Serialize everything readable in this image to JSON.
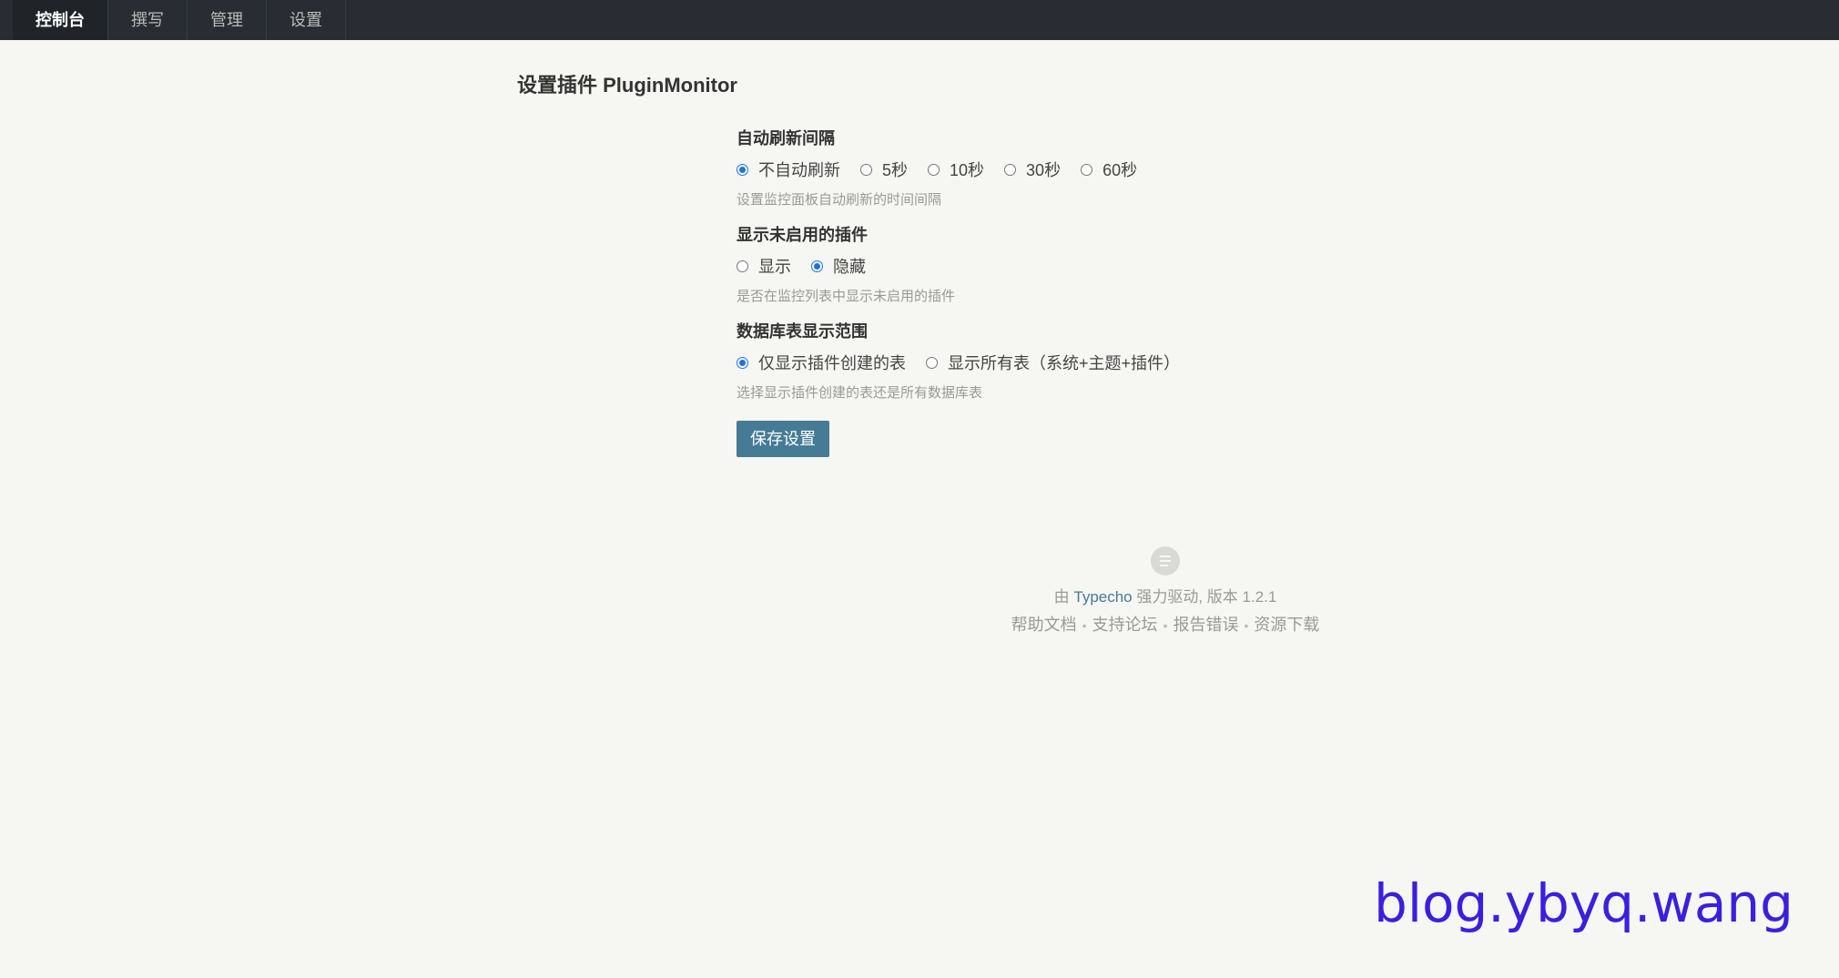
{
  "nav": {
    "items": [
      {
        "label": "控制台",
        "active": true
      },
      {
        "label": "撰写",
        "active": false
      },
      {
        "label": "管理",
        "active": false
      },
      {
        "label": "设置",
        "active": false
      }
    ]
  },
  "page": {
    "title": "设置插件 PluginMonitor"
  },
  "form": {
    "refresh": {
      "label": "自动刷新间隔",
      "options": [
        {
          "label": "不自动刷新",
          "checked": true
        },
        {
          "label": "5秒",
          "checked": false
        },
        {
          "label": "10秒",
          "checked": false
        },
        {
          "label": "30秒",
          "checked": false
        },
        {
          "label": "60秒",
          "checked": false
        }
      ],
      "description": "设置监控面板自动刷新的时间间隔"
    },
    "disabled_plugins": {
      "label": "显示未启用的插件",
      "options": [
        {
          "label": "显示",
          "checked": false
        },
        {
          "label": "隐藏",
          "checked": true
        }
      ],
      "description": "是否在监控列表中显示未启用的插件"
    },
    "db_scope": {
      "label": "数据库表显示范围",
      "options": [
        {
          "label": "仅显示插件创建的表",
          "checked": true
        },
        {
          "label": "显示所有表（系统+主题+插件）",
          "checked": false
        }
      ],
      "description": "选择显示插件创建的表还是所有数据库表"
    },
    "save_label": "保存设置"
  },
  "footer": {
    "credit_prefix": "由 ",
    "brand": "Typecho",
    "credit_suffix": " 强力驱动, 版本 1.2.1",
    "links": [
      "帮助文档",
      "支持论坛",
      "报告错误",
      "资源下载"
    ],
    "separator": "•"
  },
  "watermark": "blog.ybyq.wang",
  "colors": {
    "nav_bg": "#292d33",
    "accent": "#467b96",
    "radio_checked": "#1a73e8",
    "watermark": "#3a1fe0"
  }
}
